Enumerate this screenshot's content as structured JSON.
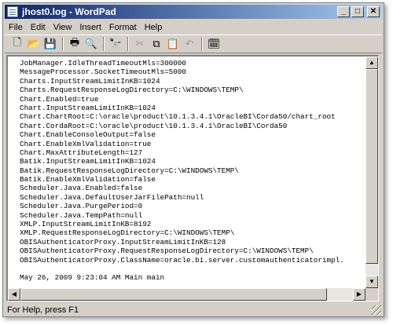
{
  "window": {
    "title": "jhost0.log - WordPad"
  },
  "caption_buttons": {
    "minimize": "_",
    "maximize": "□",
    "close": "✕"
  },
  "menu": [
    "File",
    "Edit",
    "View",
    "Insert",
    "Format",
    "Help"
  ],
  "toolbar": [
    {
      "name": "new-document-icon",
      "glyph": "🗋",
      "enabled": true
    },
    {
      "name": "open-folder-icon",
      "glyph": "📂",
      "enabled": true
    },
    {
      "name": "save-icon",
      "glyph": "💾",
      "enabled": true
    },
    {
      "sep": true
    },
    {
      "name": "print-icon",
      "glyph": "🖶",
      "enabled": true
    },
    {
      "name": "print-preview-icon",
      "glyph": "🔍",
      "enabled": true
    },
    {
      "sep": true
    },
    {
      "name": "find-icon",
      "glyph": "🔭",
      "enabled": true
    },
    {
      "sep": true
    },
    {
      "name": "cut-icon",
      "glyph": "✂",
      "enabled": false
    },
    {
      "name": "copy-icon",
      "glyph": "⧉",
      "enabled": true
    },
    {
      "name": "paste-icon",
      "glyph": "📋",
      "enabled": true
    },
    {
      "name": "undo-icon",
      "glyph": "↶",
      "enabled": false
    },
    {
      "sep": true
    },
    {
      "name": "insert-date-time-icon",
      "glyph": "🗓",
      "enabled": true
    }
  ],
  "document": {
    "lines": [
      "JobManager.IdleThreadTimeoutMls=300000",
      "MessageProcessor.SocketTimeoutMls=5000",
      "Charts.InputStreamLimitInKB=1024",
      "Charts.RequestResponseLogDirectory=C:\\WINDOWS\\TEMP\\",
      "Chart.Enabled=true",
      "Chart.InputStreamLimitInKB=1024",
      "Chart.ChartRoot=C:\\oracle\\product\\10.1.3.4.1\\OracleBI\\Corda50/chart_root",
      "Chart.CordaRoot=C:\\oracle\\product\\10.1.3.4.1\\OracleBI\\Corda50",
      "Chart.EnableConsoleOutput=false",
      "Chart.EnableXmlValidation=true",
      "Chart.MaxAttributeLength=127",
      "Batik.InputStreamLimitInKB=1024",
      "Batik.RequestResponseLogDirectory=C:\\WINDOWS\\TEMP\\",
      "Batik.EnableXmlValidation=false",
      "Scheduler.Java.Enabled=false",
      "Scheduler.Java.DefaultUserJarFilePath=null",
      "Scheduler.Java.PurgePeriod=0",
      "Scheduler.Java.TempPath=null",
      "XMLP.InputStreamLimitInKB=8192",
      "XMLP.RequestResponseLogDirectory=C:\\WINDOWS\\TEMP\\",
      "OBISAuthenticatorProxy.InputStreamLimitInKB=128",
      "OBISAuthenticatorProxy.RequestResponseLogDirectory=C:\\WINDOWS\\TEMP\\",
      "OBISAuthenticatorProxy.ClassName=oracle.bi.server.customauthenticatorimpl.",
      "",
      "May 26, 2009 9:23:04 AM Main main"
    ]
  },
  "status": {
    "text": "For Help, press F1"
  },
  "scroll_arrows": {
    "up": "▲",
    "down": "▼",
    "left": "◀",
    "right": "▶"
  }
}
